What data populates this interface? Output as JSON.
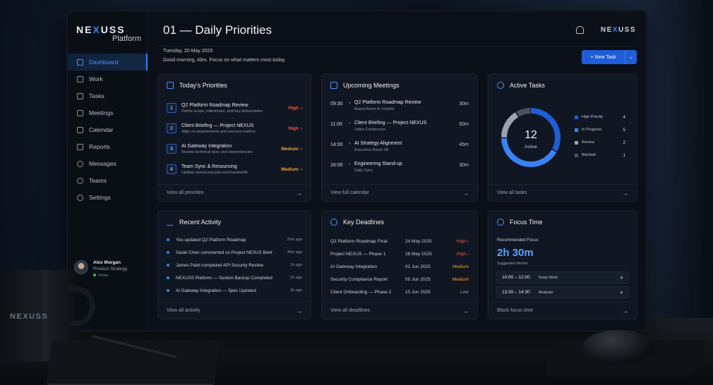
{
  "app": {
    "brand_pre": "NE",
    "brand_mid": "X",
    "brand_post": "USS",
    "brand_sub": "Platform"
  },
  "header": {
    "title": "01 — Daily Priorities",
    "date": "Tuesday, 20 May 2025",
    "greeting": "Good morning, Alex. Focus on what matters most today.",
    "new_task": "New Task",
    "new_task_icon": "+",
    "dropdown_icon": "⌄"
  },
  "sidebar": {
    "items": [
      {
        "label": "Dashboard"
      },
      {
        "label": "Work"
      },
      {
        "label": "Tasks"
      },
      {
        "label": "Meetings"
      },
      {
        "label": "Calendar"
      },
      {
        "label": "Reports"
      },
      {
        "label": "Messages"
      },
      {
        "label": "Teams"
      },
      {
        "label": "Settings"
      }
    ]
  },
  "user": {
    "name": "Alex Morgan",
    "role": "Product Strategy",
    "status": "Online"
  },
  "priorities": {
    "title": "Today's Priorities",
    "footer": "View all priorities",
    "items": [
      {
        "n": "1",
        "title": "Q2 Platform Roadmap Review",
        "desc": "Define scope, milestones, and key deliverables",
        "tag": "High"
      },
      {
        "n": "2",
        "title": "Client Briefing — Project NEXUS",
        "desc": "Align on requirements and success metrics",
        "tag": "High"
      },
      {
        "n": "3",
        "title": "AI Gateway Integration",
        "desc": "Review technical spec and dependencies",
        "tag": "Medium"
      },
      {
        "n": "4",
        "title": "Team Sync & Resourcing",
        "desc": "Update resourcing plan and bandwidth",
        "tag": "Medium"
      }
    ]
  },
  "meetings": {
    "title": "Upcoming Meetings",
    "footer": "View full calendar",
    "items": [
      {
        "time": "09:30",
        "title": "Q2 Platform Roadmap Review",
        "loc": "Board Room A / Hybrid",
        "dur": "30m"
      },
      {
        "time": "11:00",
        "title": "Client Briefing — Project NEXUS",
        "loc": "Video Conference",
        "dur": "60m"
      },
      {
        "time": "14:00",
        "title": "AI Strategy Alignment",
        "loc": "Executive Room 2B",
        "dur": "45m"
      },
      {
        "time": "16:00",
        "title": "Engineering Stand-up",
        "loc": "Daily Sync",
        "dur": "30m"
      }
    ]
  },
  "active_tasks": {
    "title": "Active Tasks",
    "footer": "View all tasks",
    "total": "12",
    "total_label": "Active",
    "legend": [
      {
        "label": "High Priority",
        "value": 4,
        "color": "#1f5ed6"
      },
      {
        "label": "In Progress",
        "value": 5,
        "color": "#3b82f6"
      },
      {
        "label": "Review",
        "value": 2,
        "color": "#9aa3b2"
      },
      {
        "label": "Blocked",
        "value": 1,
        "color": "#4b5261"
      }
    ]
  },
  "activity": {
    "title": "Recent Activity",
    "footer": "View all activity",
    "items": [
      {
        "text": "You updated Q2 Platform Roadmap",
        "ago": "20m ago"
      },
      {
        "text": "Sarah Chen commented on Project NEXUS Brief",
        "ago": "45m ago"
      },
      {
        "text": "James Patel completed API Security Review",
        "ago": "1h ago"
      },
      {
        "text": "NEXUSS Platform — System Backup Completed",
        "ago": "2h ago"
      },
      {
        "text": "AI Gateway Integration — Spec Updated",
        "ago": "3h ago"
      }
    ]
  },
  "deadlines": {
    "title": "Key Deadlines",
    "footer": "View all deadlines",
    "items": [
      {
        "name": "Q2 Platform Roadmap Final",
        "date": "24 May 2025",
        "prio": "High"
      },
      {
        "name": "Project NEXUS — Phase 1",
        "date": "28 May 2025",
        "prio": "High"
      },
      {
        "name": "AI Gateway Integration",
        "date": "02 Jun 2025",
        "prio": "Medium"
      },
      {
        "name": "Security Compliance Report",
        "date": "05 Jun 2025",
        "prio": "Medium"
      },
      {
        "name": "Client Onboarding — Phase 2",
        "date": "10 Jun 2025",
        "prio": "Low"
      }
    ]
  },
  "focus": {
    "title": "Focus Time",
    "footer": "Block focus time",
    "rec_label": "Recommended Focus",
    "value": "2h 30m",
    "suggested": "Suggested blocks",
    "blocks": [
      {
        "time": "10:00 – 12:00",
        "label": "Deep Work"
      },
      {
        "time": "13:30 – 14:30",
        "label": "Analysis"
      }
    ]
  },
  "mug_brand": "NEXUSS",
  "icons": {
    "arrow": "→",
    "chevron": "›",
    "plus": "+",
    "bell": "bell-icon"
  }
}
